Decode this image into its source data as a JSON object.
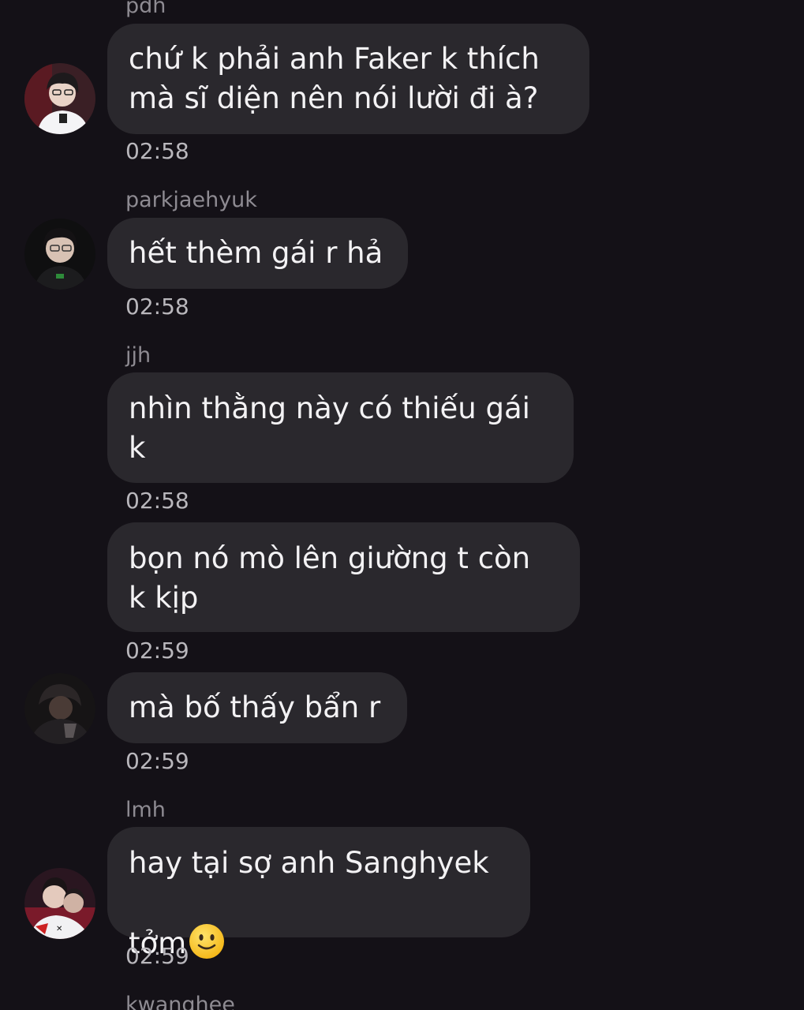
{
  "messages": [
    {
      "sender": "pdh",
      "text": "chứ k phải anh Faker k thích\nmà sĩ diện nên nói lười đi à?",
      "time": "02:58"
    },
    {
      "sender": "parkjaehyuk",
      "text": "hết thèm gái r hả",
      "time": "02:58"
    },
    {
      "sender": "jjh",
      "text": "nhìn thằng này có thiếu gái\nk",
      "time": "02:58"
    },
    {
      "sender": "",
      "text": "bọn nó mò lên giường t còn\nk kịp",
      "time": "02:59"
    },
    {
      "sender": "",
      "text": "mà bố thấy bẩn r",
      "time": "02:59"
    },
    {
      "sender": "lmh",
      "text": "hay tại sợ anh Sanghyek\ntởm",
      "emoji": "slightly-smiling-face",
      "time": "02:59"
    },
    {
      "sender": "kwanghee",
      "text": "",
      "time": ""
    }
  ],
  "avatars": [
    {
      "icon": "user-photo-avatar-pdh"
    },
    {
      "icon": "user-photo-avatar-parkjaehyuk"
    },
    {
      "icon": "user-photo-avatar-jjh"
    },
    {
      "icon": "user-photo-avatar-lmh"
    }
  ],
  "colors": {
    "background": "#141117",
    "bubble": "#2a282d",
    "text": "#f3f2f4",
    "sender": "#8e8b92",
    "time": "#b9b7bc"
  }
}
